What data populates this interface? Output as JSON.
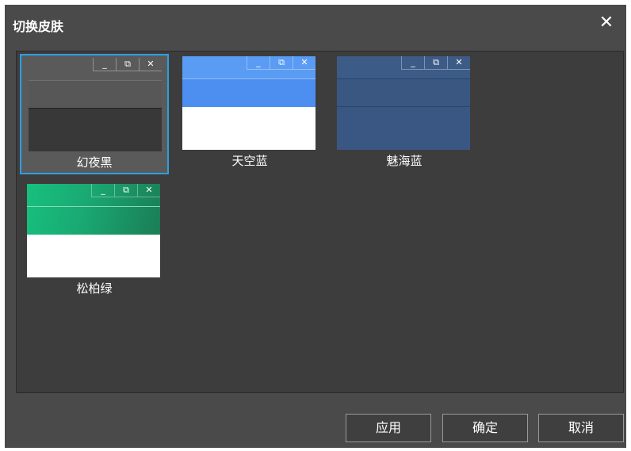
{
  "dialog": {
    "title": "切换皮肤",
    "close_symbol": "✕"
  },
  "skins": [
    {
      "label": "幻夜黑",
      "selected": true,
      "colors": {
        "top": "#555555",
        "divider": "#2e2e2e",
        "bottom": "#383838",
        "divider_top": "#6a6a6a"
      }
    },
    {
      "label": "天空蓝",
      "selected": false,
      "colors": {
        "top": "#4d8fee",
        "divider": "#7fb2f5",
        "bottom": "#ffffff",
        "top_upper": "#5d9df3"
      }
    },
    {
      "label": "魅海蓝",
      "selected": false,
      "colors": {
        "top": "#3c5a86",
        "divider": "#2a4268",
        "bottom": "#3a5783"
      }
    },
    {
      "label": "松柏绿",
      "selected": false,
      "colors": {
        "top_left": "#1cb57a",
        "top_right": "#1d8a5f",
        "divider": "#7fe0b8",
        "bottom": "#ffffff"
      }
    }
  ],
  "window_controls": {
    "minimize": "_",
    "restore": "⧉",
    "close": "✕"
  },
  "footer": {
    "apply_label": "应用",
    "ok_label": "确定",
    "cancel_label": "取消"
  },
  "colors": {
    "selection_border": "#2e9fe0",
    "dialog_bg": "#4a4a4a"
  }
}
